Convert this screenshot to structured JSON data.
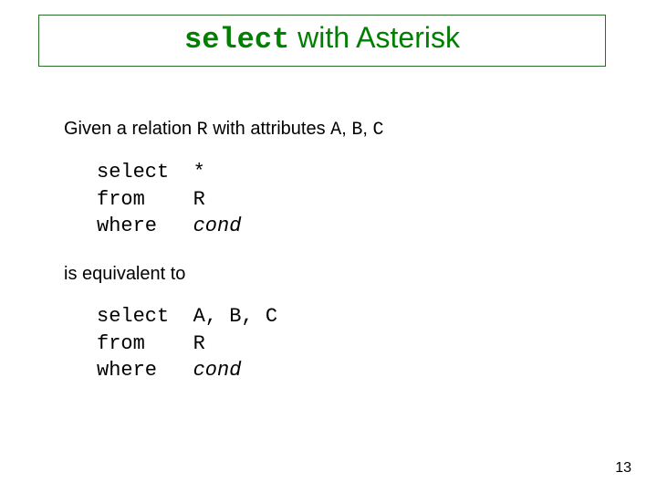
{
  "title": {
    "keyword": "select",
    "rest": " with Asterisk"
  },
  "intro": {
    "t1": "Given a relation ",
    "rel": "R",
    "t2": " with attributes ",
    "a": "A",
    "c1": ", ",
    "b": "B",
    "c2": ", ",
    "c": "C"
  },
  "block1": {
    "r1": {
      "kw": "select",
      "arg": "*"
    },
    "r2": {
      "kw": "from",
      "arg": "R"
    },
    "r3": {
      "kw": "where",
      "arg": "cond"
    }
  },
  "equiv": "is equivalent to",
  "block2": {
    "r1": {
      "kw": "select",
      "arg": "A, B, C"
    },
    "r2": {
      "kw": "from",
      "arg": "R"
    },
    "r3": {
      "kw": "where",
      "arg": "cond"
    }
  },
  "pagenum": "13"
}
